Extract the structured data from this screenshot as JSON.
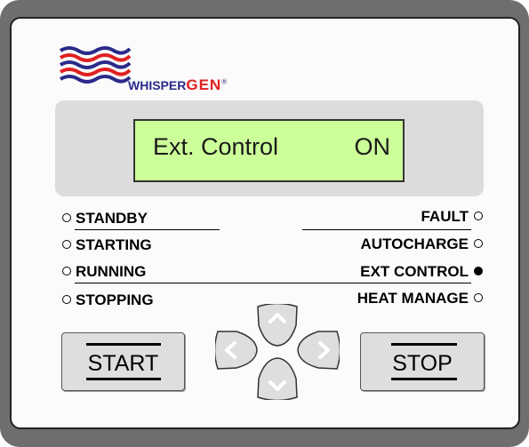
{
  "brand": {
    "name_part1": "WHISPER",
    "name_part2": "GEN",
    "reg_mark": "®"
  },
  "display": {
    "text_left": "Ext. Control",
    "text_right": "ON"
  },
  "indicators_left": [
    {
      "label": "STANDBY",
      "lit": false
    },
    {
      "label": "STARTING",
      "lit": false
    },
    {
      "label": "RUNNING",
      "lit": false
    },
    {
      "label": "STOPPING",
      "lit": false
    }
  ],
  "indicators_right": [
    {
      "label": "FAULT",
      "lit": false
    },
    {
      "label": "AUTOCHARGE",
      "lit": false
    },
    {
      "label": "EXT CONTROL",
      "lit": true
    },
    {
      "label": "HEAT MANAGE",
      "lit": false
    }
  ],
  "buttons": {
    "start_label": "START",
    "stop_label": "STOP"
  },
  "nav_keys": [
    "up-arrow-icon",
    "left-arrow-icon",
    "right-arrow-icon",
    "down-arrow-icon"
  ],
  "colors": {
    "lcd_background": "#ccff99",
    "frame": "#6e6e6e",
    "brand_red": "#e02020",
    "brand_blue": "#2a2a8a"
  }
}
